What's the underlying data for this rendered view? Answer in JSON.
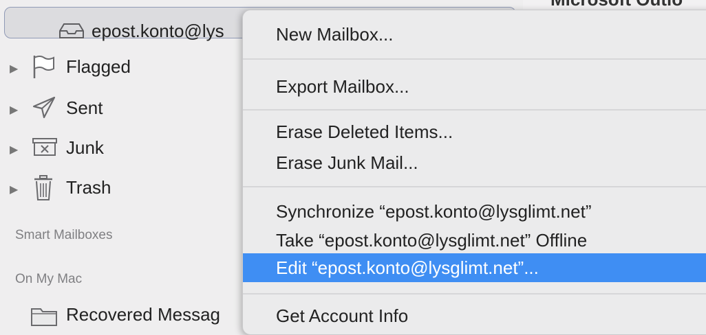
{
  "sidebar": {
    "account": {
      "label": "epost.konto@lys"
    },
    "mailboxes": [
      {
        "label": "Flagged"
      },
      {
        "label": "Sent"
      },
      {
        "label": "Junk"
      },
      {
        "label": "Trash"
      }
    ],
    "sections": {
      "smart": "Smart Mailboxes",
      "on_my_mac": "On My Mac"
    },
    "recovered": {
      "label": "Recovered Messag"
    }
  },
  "background": {
    "partial_text": "Microsoft Outlo"
  },
  "context_menu": {
    "items": [
      {
        "label": "New Mailbox..."
      },
      {
        "label": "Export Mailbox..."
      },
      {
        "label": "Erase Deleted Items..."
      },
      {
        "label": "Erase Junk Mail..."
      },
      {
        "label": "Synchronize “epost.konto@lysglimt.net”"
      },
      {
        "label": "Take “epost.konto@lysglimt.net” Offline"
      },
      {
        "label": "Edit “epost.konto@lysglimt.net”..."
      },
      {
        "label": "Get Account Info"
      }
    ],
    "highlight_color": "#3f8ef3"
  }
}
